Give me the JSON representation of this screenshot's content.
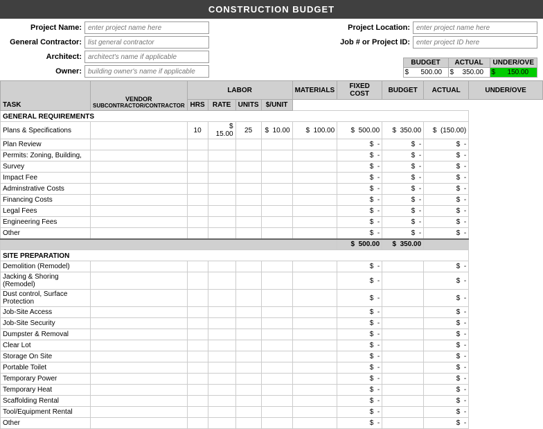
{
  "title": "CONSTRUCTION BUDGET",
  "header": {
    "project_name_label": "Project Name:",
    "project_name_placeholder": "enter project name here",
    "general_contractor_label": "General Contractor:",
    "general_contractor_placeholder": "list general contractor",
    "architect_label": "Architect:",
    "architect_placeholder": "architect's name if applicable",
    "owner_label": "Owner:",
    "owner_placeholder": "building owner's name if applicable",
    "project_location_label": "Project Location:",
    "project_location_placeholder": "enter project name here",
    "job_id_label": "Job # or Project ID:",
    "job_id_placeholder": "enter project ID here"
  },
  "summary": {
    "budget_label": "BUDGET",
    "actual_label": "ACTUAL",
    "underover_label": "UNDER/OVE",
    "budget_value": "500.00",
    "actual_value": "350.00",
    "underover_value": "150.00",
    "dollar": "$"
  },
  "table_headers": {
    "task": "TASK",
    "vendor_top": "VENDOR",
    "vendor_bot": "SUBCONTRACTOR/CONTRACTOR",
    "labor": "LABOR",
    "materials": "MATERIALS",
    "fixed_cost": "FIXED COST",
    "budget": "BUDGET",
    "actual": "ACTUAL",
    "underover": "UNDER/OVE",
    "hrs": "HRS",
    "rate": "RATE",
    "units": "UNITS",
    "unit_cost": "$/UNIT"
  },
  "sections": [
    {
      "id": "general_requirements",
      "header": "GENERAL REQUIREMENTS",
      "items": [
        {
          "task": "Plans & Specifications",
          "hrs": "10",
          "rate": "15.00",
          "units": "25",
          "unit_cost": "10.00",
          "fixed_cost": "100.00",
          "budget": "500.00",
          "actual": "350.00",
          "underover": "(150.00)",
          "underover_green": false
        },
        {
          "task": "Plan Review",
          "hrs": "",
          "rate": "",
          "units": "",
          "unit_cost": "",
          "fixed_cost": "",
          "budget": "-",
          "actual": "-",
          "underover": "-",
          "is_dollar_row": true
        },
        {
          "task": "Permits: Zoning, Building,",
          "hrs": "",
          "rate": "",
          "units": "",
          "unit_cost": "",
          "fixed_cost": "",
          "budget": "-",
          "actual": "-",
          "underover": "-",
          "is_dollar_row": true
        },
        {
          "task": "Survey",
          "hrs": "",
          "rate": "",
          "units": "",
          "unit_cost": "",
          "fixed_cost": "",
          "budget": "-",
          "actual": "-",
          "underover": "-",
          "is_dollar_row": true
        },
        {
          "task": "Impact Fee",
          "hrs": "",
          "rate": "",
          "units": "",
          "unit_cost": "",
          "fixed_cost": "",
          "budget": "-",
          "actual": "-",
          "underover": "-",
          "is_dollar_row": true
        },
        {
          "task": "Adminstrative Costs",
          "hrs": "",
          "rate": "",
          "units": "",
          "unit_cost": "",
          "fixed_cost": "",
          "budget": "-",
          "actual": "-",
          "underover": "-",
          "is_dollar_row": true
        },
        {
          "task": "Financing Costs",
          "hrs": "",
          "rate": "",
          "units": "",
          "unit_cost": "",
          "fixed_cost": "",
          "budget": "-",
          "actual": "-",
          "underover": "-",
          "is_dollar_row": true
        },
        {
          "task": "Legal Fees",
          "hrs": "",
          "rate": "",
          "units": "",
          "unit_cost": "",
          "fixed_cost": "",
          "budget": "-",
          "actual": "-",
          "underover": "-",
          "is_dollar_row": true
        },
        {
          "task": "Engineering Fees",
          "hrs": "",
          "rate": "",
          "units": "",
          "unit_cost": "",
          "fixed_cost": "",
          "budget": "-",
          "actual": "-",
          "underover": "-",
          "is_dollar_row": true
        },
        {
          "task": "Other",
          "hrs": "",
          "rate": "",
          "units": "",
          "unit_cost": "",
          "fixed_cost": "",
          "budget": "-",
          "actual": "-",
          "underover": "-",
          "is_dollar_row": true
        }
      ],
      "total": {
        "budget": "500.00",
        "actual": "350.00",
        "underover": ""
      }
    },
    {
      "id": "site_preparation",
      "header": "SITE PREPARATION",
      "items": [
        {
          "task": "Demolition (Remodel)",
          "is_dollar_row": true,
          "budget": "-",
          "actual": "",
          "underover": "-"
        },
        {
          "task": "Jacking & Shoring (Remodel)",
          "is_dollar_row": true,
          "budget": "-",
          "actual": "",
          "underover": "-"
        },
        {
          "task": "Dust control, Surface Protection",
          "is_dollar_row": true,
          "budget": "-",
          "actual": "",
          "underover": "-"
        },
        {
          "task": "Job-Site Access",
          "is_dollar_row": true,
          "budget": "-",
          "actual": "",
          "underover": "-"
        },
        {
          "task": "Job-Site Security",
          "is_dollar_row": true,
          "budget": "-",
          "actual": "",
          "underover": "-"
        },
        {
          "task": "Dumpster & Removal",
          "is_dollar_row": true,
          "budget": "-",
          "actual": "",
          "underover": "-"
        },
        {
          "task": "Clear Lot",
          "is_dollar_row": true,
          "budget": "-",
          "actual": "",
          "underover": "-"
        },
        {
          "task": "Storage On Site",
          "is_dollar_row": true,
          "budget": "-",
          "actual": "",
          "underover": "-"
        },
        {
          "task": "Portable Toilet",
          "is_dollar_row": true,
          "budget": "-",
          "actual": "",
          "underover": "-"
        },
        {
          "task": "Temporary Power",
          "is_dollar_row": true,
          "budget": "-",
          "actual": "",
          "underover": "-"
        },
        {
          "task": "Temporary Heat",
          "is_dollar_row": true,
          "budget": "-",
          "actual": "",
          "underover": "-"
        },
        {
          "task": "Scaffolding Rental",
          "is_dollar_row": true,
          "budget": "-",
          "actual": "",
          "underover": "-"
        },
        {
          "task": "Tool/Equipment Rental",
          "is_dollar_row": true,
          "budget": "-",
          "actual": "",
          "underover": "-"
        },
        {
          "task": "Other",
          "is_dollar_row": true,
          "budget": "-",
          "actual": "",
          "underover": "-"
        }
      ]
    }
  ]
}
